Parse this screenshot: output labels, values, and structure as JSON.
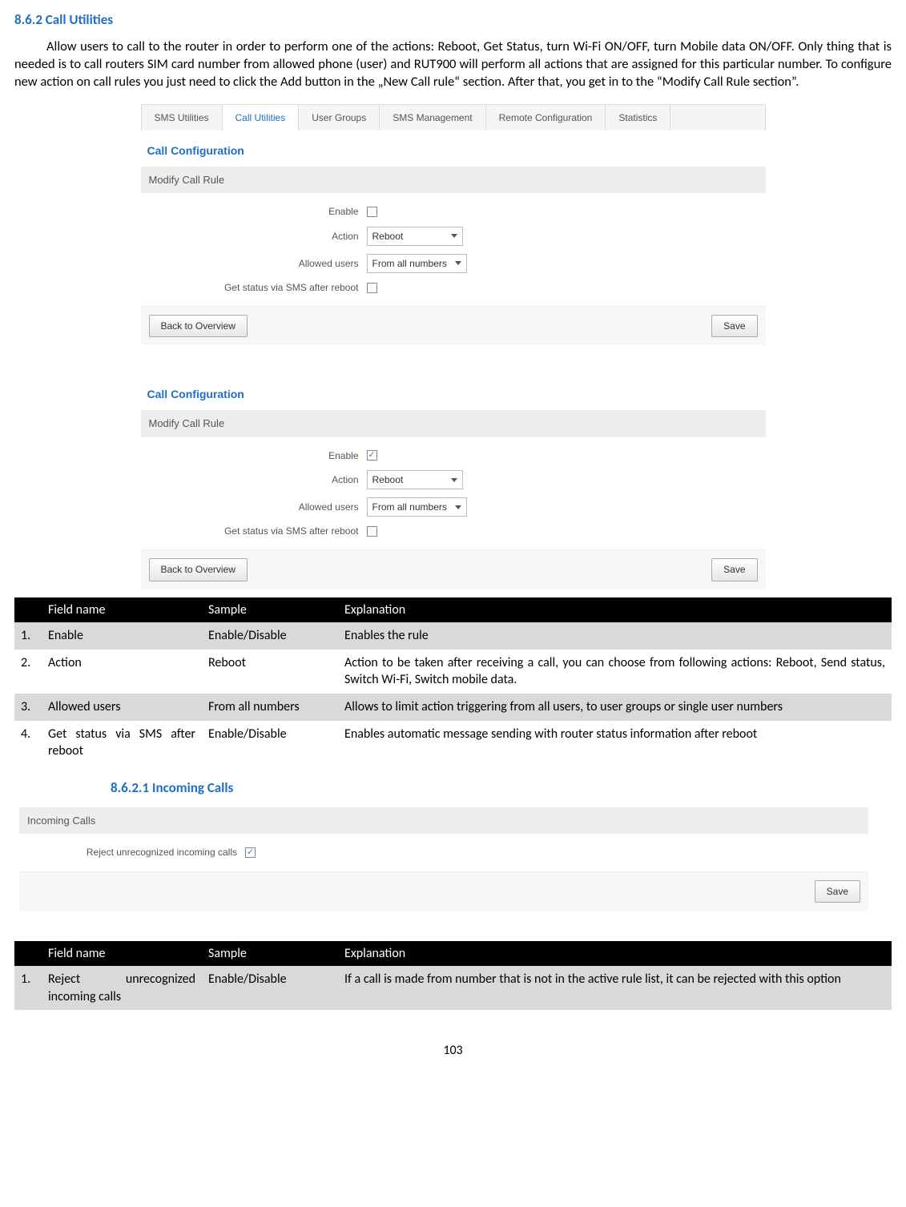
{
  "headings": {
    "s862": "8.6.2  Call Utilities",
    "s8621": "8.6.2.1    Incoming Calls"
  },
  "paragraph": "Allow users to call to the router in order to perform one of the actions:  Reboot, Get Status, turn Wi-Fi ON/OFF, turn Mobile data ON/OFF. Only thing that is needed is to call routers SIM card number from allowed phone (user) and RUT900 will perform all actions that are assigned for this particular number. To configure new action on call rules you just need to click the Add button in the „New Call rule“ section. After that, you get in to the “Modify Call Rule section”.",
  "page_number": "103",
  "tabs": {
    "t1": "SMS Utilities",
    "t2": "Call Utilities",
    "t3": "User Groups",
    "t4": "SMS Management",
    "t5": "Remote Configuration",
    "t6": "Statistics"
  },
  "panel": {
    "title": "Call Configuration",
    "sub": "Modify Call Rule",
    "labels": {
      "enable": "Enable",
      "action": "Action",
      "allowed": "Allowed users",
      "getstatus": "Get status via SMS after reboot"
    },
    "values": {
      "action": "Reboot",
      "allowed": "From all numbers"
    },
    "buttons": {
      "back": "Back to Overview",
      "save": "Save"
    }
  },
  "incoming_panel": {
    "title": "Incoming Calls",
    "label": "Reject unrecognized incoming calls",
    "save": "Save"
  },
  "table1": {
    "head": {
      "n": "",
      "f": "Field name",
      "s": "Sample",
      "e": "Explanation"
    },
    "rows": [
      {
        "n": "1.",
        "f": "Enable",
        "s": "Enable/Disable",
        "e": "Enables the rule"
      },
      {
        "n": "2.",
        "f": "Action",
        "s": "Reboot",
        "e": "Action to be taken after receiving a call, you can choose from following actions: Reboot, Send status, Switch Wi-Fi, Switch mobile data."
      },
      {
        "n": "3.",
        "f": "Allowed users",
        "s": "From all numbers",
        "e": "Allows to limit action triggering from all users, to user groups or single user numbers"
      },
      {
        "n": "4.",
        "f": "Get status via SMS after reboot",
        "s": "Enable/Disable",
        "e": "Enables automatic message sending with router status information after reboot"
      }
    ]
  },
  "table2": {
    "head": {
      "n": "",
      "f": "Field name",
      "s": "Sample",
      "e": "Explanation"
    },
    "rows": [
      {
        "n": "1.",
        "f": "Reject unrecognized incoming calls",
        "s": "Enable/Disable",
        "e": "If a call is made from number that is not in the active rule list, it can be rejected with this option"
      }
    ]
  }
}
